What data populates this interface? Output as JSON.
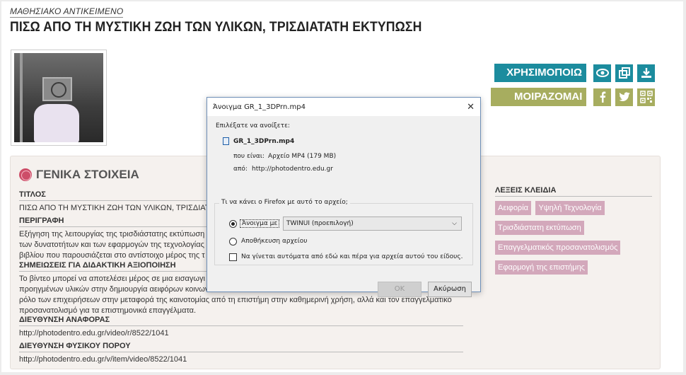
{
  "header": {
    "kicker": "ΜΑΘΗΣΙΑΚΟ ΑΝΤΙΚΕΙΜΕΝΟ",
    "title": "ΠΙΣΩ ΑΠΟ ΤΗ ΜΥΣΤΙΚΗ ΖΩΗ ΤΩΝ ΥΛΙΚΩΝ, ΤΡΙΣΔΙΑΤΑΤΗ ΕΚΤΥΠΩΣΗ"
  },
  "actions": {
    "use_label": "ΧΡΗΣΙΜΟΠΟΙΩ",
    "share_label": "ΜΟΙΡΑΖΟΜΑΙ",
    "icons": [
      "eye-icon",
      "copy-icon",
      "download-icon",
      "facebook-icon",
      "twitter-icon",
      "qr-code-icon"
    ],
    "colors": {
      "use": "#1c8c9e",
      "share": "#a7ad5f"
    }
  },
  "general": {
    "section_title": "ΓΕΝΙΚΑ ΣΤΟΙΧΕΙΑ",
    "fields": [
      {
        "label": "ΤΙΤΛΟΣ",
        "value": "ΠΙΣΩ ΑΠΟ ΤΗ ΜΥΣΤΙΚΗ ΖΩΗ ΤΩΝ ΥΛΙΚΩΝ, ΤΡΙΣΔΙΑΤΑΤΗ"
      },
      {
        "label": "ΠΕΡΙΓΡΑΦΗ",
        "value": "Εξήγηση της λειτουργίας της τρισδιάστατης εκτύπωση\nτων δυνατοτήτων και των εφαρμογών της τεχνολογίας\nβιβλίου που παρουσιάζεται στο αντίστοιχο μέρος της τ"
      },
      {
        "label": "ΣΗΜΕΙΩΣΕΙΣ ΓΙΑ ΔΙΔΑΚΤΙΚΗ ΑΞΙΟΠΟΙΗΣΗ",
        "value": "Το βίντεο μπορεί να αποτελέσει μέρος σε μια εισαγωγι\nπροηγμένων υλικών στην δημιουργία αειφόρων κοινων\nρόλο των επιχειρήσεων στην μεταφορά της καινοτομίας από τη επιστήμη στην καθημερινή χρήση, αλλά και τον επαγγελματικό\nπροσανατολισμό για τα επιστημονικά επαγγέλματα."
      },
      {
        "label": "ΔΙΕΥΘΥΝΣΗ ΑΝΑΦΟΡΑΣ",
        "value": "http://photodentro.edu.gr/video/r/8522/1041"
      },
      {
        "label": "ΔΙΕΥΘΥΝΣΗ ΦΥΣΙΚΟΥ ΠΟΡΟΥ",
        "value": "http://photodentro.edu.gr/v/item/video/8522/1041"
      }
    ]
  },
  "keywords": {
    "label": "ΛΕΞΕΙΣ ΚΛΕΙΔΙΑ",
    "tags": [
      "Αειφορία",
      "Υψηλή Τεχνολογία",
      "Τρισδιάστατη εκτύπωση",
      "Επαγγελματικός προσανατολισμός",
      "Εφαρμογή της επιστήμης"
    ],
    "color": "#d3a8bb"
  },
  "dialog": {
    "title": "Άνοιγμα GR_1_3DPrn.mp4",
    "chosen_label": "Επιλέξατε να ανοίξετε:",
    "filename": "GR_1_3DPrn.mp4",
    "type_label": "που είναι:",
    "type_value": "Αρχείο MP4 (179 MB)",
    "from_label": "από:",
    "from_value": "http://photodentro.edu.gr",
    "group_caption": "Τι να κάνει ο Firefox  με αυτό το αρχείο;",
    "open_with_label": "Άνοιγμα με",
    "open_with_value": "TWINUI (προεπιλογή)",
    "save_label": "Αποθήκευση αρχείου",
    "auto_label": "Να γίνεται αυτόματα από εδώ και πέρα για αρχεία αυτού του είδους.",
    "ok_label": "OK",
    "cancel_label": "Ακύρωση"
  }
}
